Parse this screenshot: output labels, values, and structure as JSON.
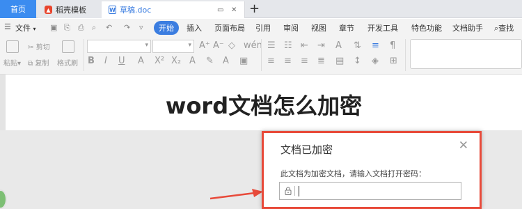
{
  "tabs": {
    "home": "首页",
    "template": "稻壳模板",
    "doc": "草稿.doc",
    "add": "+"
  },
  "menu": {
    "file": "文件",
    "items": [
      "开始",
      "插入",
      "页面布局",
      "引用",
      "审阅",
      "视图",
      "章节",
      "开发工具",
      "特色功能",
      "文档助手"
    ],
    "search": "查找"
  },
  "ribbon": {
    "paste": "粘贴",
    "cut": "剪切",
    "copy": "复制",
    "format_painter": "格式刷"
  },
  "document": {
    "title": "word文档怎么加密"
  },
  "dialog": {
    "title": "文档已加密",
    "message": "此文档为加密文档，请输入文档打开密码：",
    "password_value": ""
  },
  "colors": {
    "accent": "#3b7de0",
    "highlight_border": "#e84a3a",
    "arrow": "#e84a3a"
  }
}
